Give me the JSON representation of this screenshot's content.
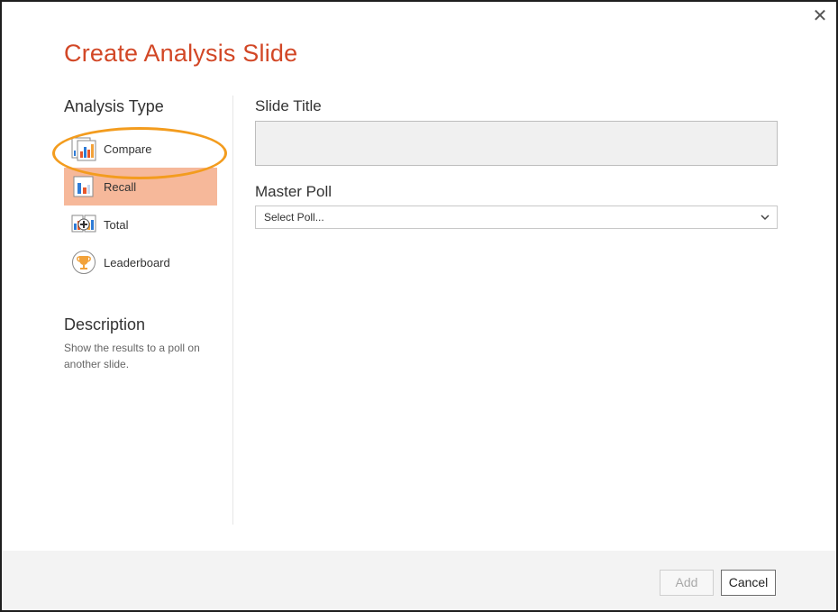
{
  "dialog": {
    "title": "Create Analysis Slide",
    "close_icon": "close-icon",
    "close_glyph": "✕"
  },
  "analysis_type": {
    "heading": "Analysis Type",
    "selected": "Recall",
    "items": [
      {
        "label": "Compare",
        "icon": "compare-chart-icon"
      },
      {
        "label": "Recall",
        "icon": "recall-chart-icon"
      },
      {
        "label": "Total",
        "icon": "total-chart-icon"
      },
      {
        "label": "Leaderboard",
        "icon": "trophy-icon"
      }
    ]
  },
  "description": {
    "heading": "Description",
    "text": "Show the results to a poll on another slide."
  },
  "slide_title": {
    "label": "Slide Title",
    "value": "",
    "placeholder": ""
  },
  "master_poll": {
    "label": "Master Poll",
    "selected_value": "Select Poll...",
    "icon": "chevron-down-icon"
  },
  "footer": {
    "add_label": "Add",
    "cancel_label": "Cancel",
    "add_enabled": false
  },
  "colors": {
    "title": "#d24726",
    "selected_item_bg": "#f6b89a",
    "highlight_ring": "#f39c1e",
    "footer_bg": "#f3f3f3"
  }
}
